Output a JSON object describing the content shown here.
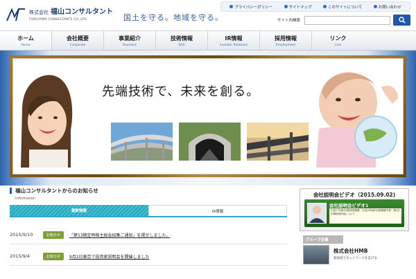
{
  "header": {
    "company_prefix": "株式会社",
    "company_name": "福山コンサルタント",
    "company_en": "FUKUYAMA CONSULTANTS CO.,LTD",
    "slogan": "国土を守る。地域を守る。"
  },
  "top_links": [
    {
      "label": "プライバシーポリシー"
    },
    {
      "label": "サイトマップ"
    },
    {
      "label": "このサイトについて"
    },
    {
      "label": "お問い合わせ"
    }
  ],
  "search": {
    "label": "サイト内検索",
    "value": "",
    "placeholder": ""
  },
  "nav": [
    {
      "jp": "ホーム",
      "en": "Home"
    },
    {
      "jp": "会社概要",
      "en": "Corporate"
    },
    {
      "jp": "事業紹介",
      "en": "Business"
    },
    {
      "jp": "技術情報",
      "en": "Skill"
    },
    {
      "jp": "IR情報",
      "en": "Investor Relations"
    },
    {
      "jp": "採用情報",
      "en": "Employment"
    },
    {
      "jp": "リンク",
      "en": "Link"
    }
  ],
  "hero": {
    "tagline": "先端技術で、未来を創る。"
  },
  "news": {
    "title": "福山コンサルタントからのお知らせ",
    "subtitle": "Information",
    "tabs": [
      {
        "label": "最新情報",
        "active": true
      },
      {
        "label": "IR情報",
        "active": false
      }
    ],
    "items": [
      {
        "date": "2015/9/10",
        "badge": "お知らせ",
        "text": "「第53期定時株主総会招集ご通知」を掲示しました。"
      },
      {
        "date": "2015/9/4",
        "badge": "お知らせ",
        "text": "9月2日東京で投資家説明会を開催しました"
      }
    ]
  },
  "video": {
    "title": "会社説明会ビデオ（2015.09.02)",
    "banner_title": "会社説明会ビデオ1",
    "banner_desc": "平成27年度3月期決算概要・平成28年度3月期業績予想・第3次中期経営計画について"
  },
  "group": {
    "heading": "グループ企業",
    "company": "株式会社HMB",
    "desc": "新技術でネットワークを広げる"
  },
  "colors": {
    "brand_blue": "#1f57b0",
    "teal_tab": "#27a7bf",
    "badge_green": "#7ea037",
    "frame_gold": "#8a6324"
  }
}
